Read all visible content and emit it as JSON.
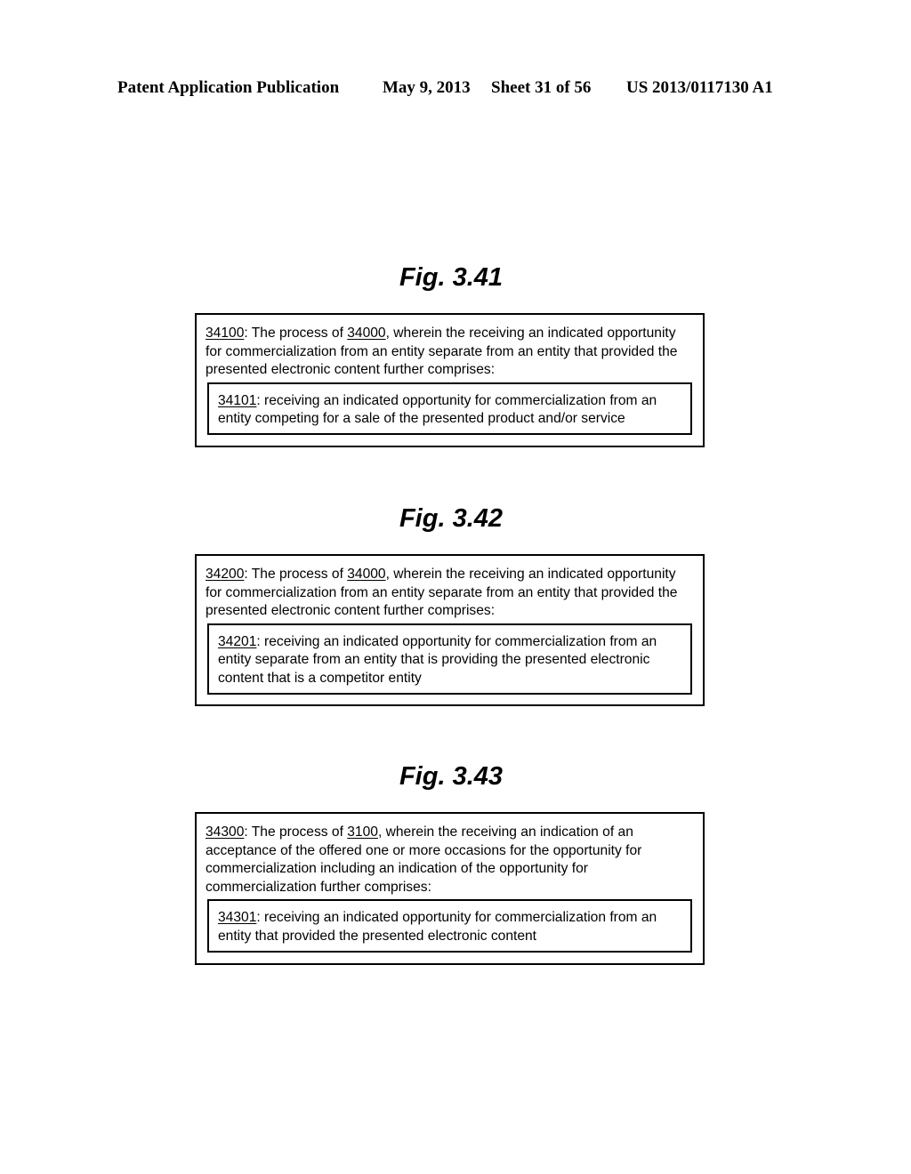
{
  "header": {
    "publication": "Patent Application Publication",
    "date": "May 9, 2013",
    "sheet": "Sheet 31 of 56",
    "number": "US 2013/0117130 A1"
  },
  "figures": [
    {
      "title": "Fig. 3.41",
      "outer": {
        "ref": "34100",
        "text_a": ": The process of ",
        "parent_ref": "34000",
        "text_b": ", wherein the receiving an indicated opportunity for commercialization from an entity separate from an entity that provided the presented electronic content further comprises:"
      },
      "inner": {
        "ref": "34101",
        "text": ": receiving an indicated opportunity for commercialization from an entity competing for a sale of the presented product and/or service"
      }
    },
    {
      "title": "Fig. 3.42",
      "outer": {
        "ref": "34200",
        "text_a": ": The process of ",
        "parent_ref": "34000",
        "text_b": ", wherein the receiving an indicated opportunity for commercialization from an entity separate from an entity that provided the presented electronic content further comprises:"
      },
      "inner": {
        "ref": "34201",
        "text": ": receiving an indicated opportunity for commercialization from an entity separate from an entity that is providing the presented electronic content that is a competitor entity"
      }
    },
    {
      "title": "Fig. 3.43",
      "outer": {
        "ref": "34300",
        "text_a": ": The process of ",
        "parent_ref": "3100",
        "text_b": ", wherein the receiving an indication of an acceptance of the offered one or more occasions for the opportunity for commercialization including an indication of the opportunity for commercialization further comprises:"
      },
      "inner": {
        "ref": "34301",
        "text": ": receiving an indicated opportunity for commercialization from an entity that provided the presented electronic content"
      }
    }
  ]
}
